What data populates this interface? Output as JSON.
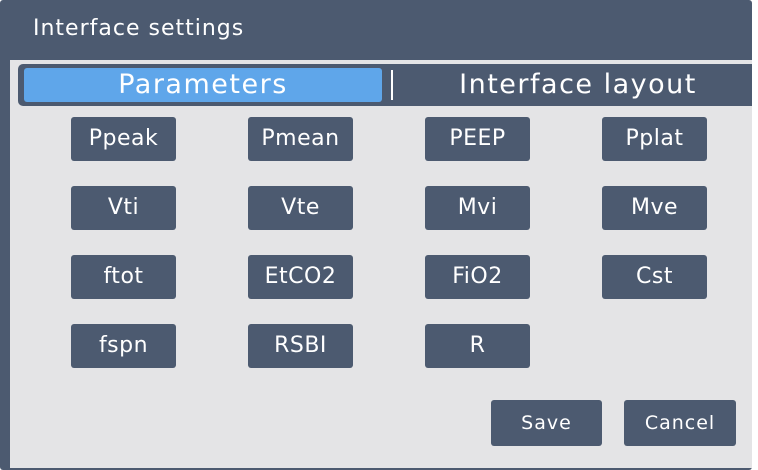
{
  "window": {
    "title": "Interface settings"
  },
  "tabs": [
    {
      "label": "Parameters",
      "active": true
    },
    {
      "label": "Interface layout",
      "active": false
    }
  ],
  "parameters": [
    "Ppeak",
    "Pmean",
    "PEEP",
    "Pplat",
    "Vti",
    "Vte",
    "Mvi",
    "Mve",
    "ftot",
    "EtCO2",
    "FiO2",
    "Cst",
    "fspn",
    "RSBI",
    "R"
  ],
  "actions": {
    "save_label": "Save",
    "cancel_label": "Cancel"
  },
  "colors": {
    "frame": "#4c5a70",
    "panel": "#e4e4e6",
    "active_tab": "#5fa6ea",
    "text": "#ffffff"
  }
}
